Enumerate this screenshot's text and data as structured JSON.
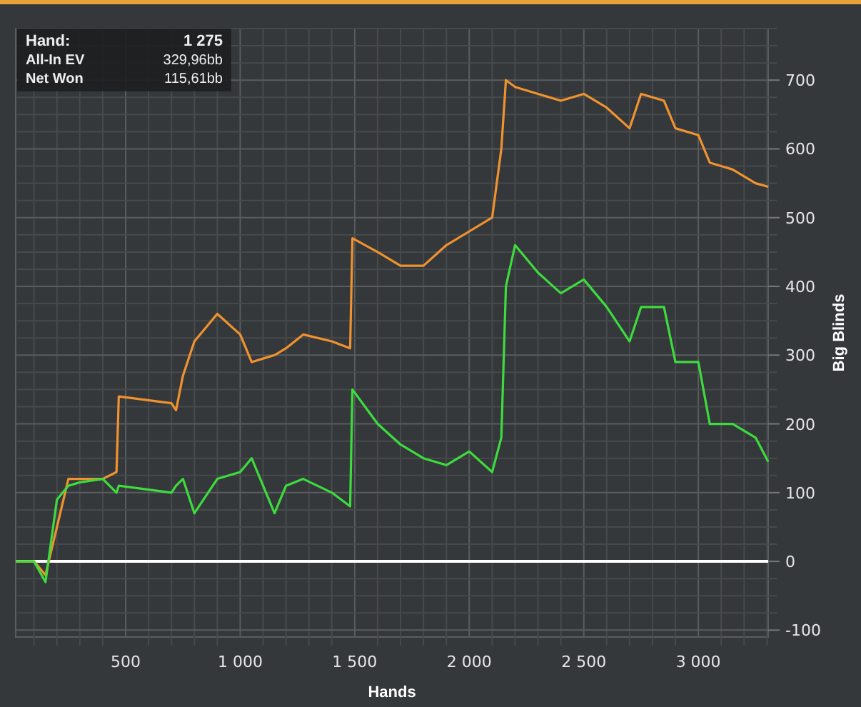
{
  "tooltip": {
    "label": "Hand:",
    "value": "1 275",
    "series_values": [
      "329,96bb",
      "115,61bb"
    ]
  },
  "chart": {
    "chart_data": {
      "type": "line",
      "xlabel": "Hands",
      "ylabel": "Big Blinds",
      "xlim": [
        20,
        3305
      ],
      "ylim": [
        -110,
        775
      ],
      "grid": true,
      "xticks": [
        {
          "value": 500,
          "label": "500"
        },
        {
          "value": 1000,
          "label": "1 000"
        },
        {
          "value": 1500,
          "label": "1 500"
        },
        {
          "value": 2000,
          "label": "2 000"
        },
        {
          "value": 2500,
          "label": "2 500"
        },
        {
          "value": 3000,
          "label": "3 000"
        }
      ],
      "yticks": [
        -100,
        0,
        100,
        200,
        300,
        400,
        500,
        600,
        700
      ],
      "x": [
        20,
        100,
        150,
        200,
        250,
        300,
        400,
        460,
        470,
        700,
        720,
        750,
        800,
        900,
        1000,
        1050,
        1100,
        1150,
        1200,
        1275,
        1400,
        1480,
        1490,
        1600,
        1700,
        1800,
        1900,
        2000,
        2100,
        2140,
        2160,
        2200,
        2300,
        2400,
        2500,
        2600,
        2700,
        2750,
        2850,
        2900,
        3000,
        3050,
        3150,
        3250,
        3305
      ],
      "series": [
        {
          "name": "All-In EV",
          "color": "#f0922e",
          "values": [
            0,
            0,
            -20,
            50,
            120,
            120,
            120,
            130,
            240,
            230,
            220,
            270,
            320,
            360,
            330,
            290,
            295,
            300,
            310,
            330,
            320,
            310,
            470,
            450,
            430,
            430,
            460,
            480,
            500,
            600,
            700,
            690,
            680,
            670,
            680,
            660,
            630,
            680,
            670,
            630,
            620,
            580,
            570,
            550,
            545
          ]
        },
        {
          "name": "Net Won",
          "color": "#3ddc3d",
          "values": [
            0,
            0,
            -30,
            90,
            110,
            115,
            120,
            100,
            110,
            100,
            110,
            120,
            70,
            120,
            130,
            150,
            110,
            70,
            110,
            120,
            100,
            80,
            250,
            200,
            170,
            150,
            140,
            160,
            130,
            180,
            400,
            460,
            420,
            390,
            410,
            370,
            320,
            370,
            370,
            290,
            290,
            200,
            200,
            180,
            145
          ]
        }
      ]
    }
  }
}
